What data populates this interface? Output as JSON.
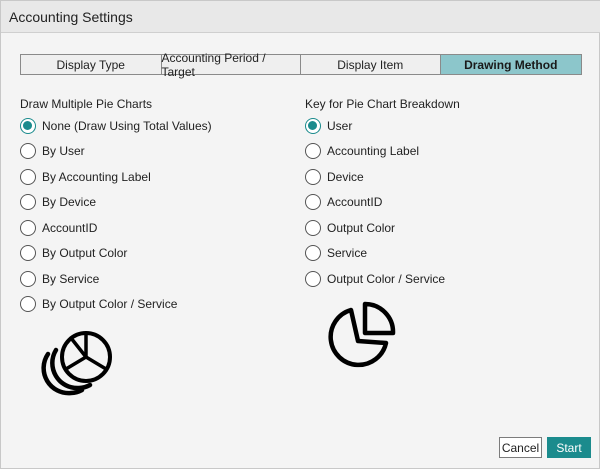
{
  "window": {
    "title": "Accounting Settings"
  },
  "tabs": [
    {
      "label": "Display Type",
      "active": false
    },
    {
      "label": "Accounting Period / Target",
      "active": false
    },
    {
      "label": "Display Item",
      "active": false
    },
    {
      "label": "Drawing Method",
      "active": true
    }
  ],
  "left_group": {
    "title": "Draw Multiple Pie Charts",
    "selected_index": 0,
    "options": [
      "None (Draw Using Total Values)",
      "By User",
      "By Accounting Label",
      "By Device",
      "AccountID",
      "By Output Color",
      "By Service",
      "By Output Color / Service"
    ],
    "illustration_icon": "multiple-pie-charts-icon"
  },
  "right_group": {
    "title": "Key for Pie Chart Breakdown",
    "selected_index": 0,
    "options": [
      "User",
      "Accounting Label",
      "Device",
      "AccountID",
      "Output Color",
      "Service",
      "Output Color / Service"
    ],
    "illustration_icon": "pie-chart-icon"
  },
  "buttons": {
    "cancel": "Cancel",
    "start": "Start"
  },
  "colors": {
    "accent": "#1b8b8d",
    "active_tab": "#8cc6cb"
  }
}
